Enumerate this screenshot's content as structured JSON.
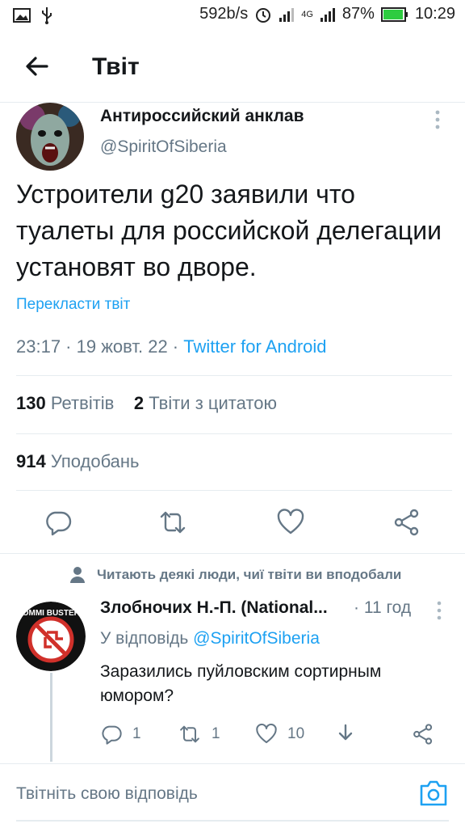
{
  "status_bar": {
    "speed": "592b/s",
    "net": "4G",
    "battery": "87%",
    "time": "10:29"
  },
  "header": {
    "title": "Твіт"
  },
  "tweet": {
    "author_name": "Антироссийский анклав",
    "author_handle": "@SpiritOfSiberia",
    "text": "Устроители g20 заявили что туалеты для российской делегации установят во дворе.",
    "translate_label": "Перекласти твіт",
    "time": "23:17 · 19 жовт. 22 · ",
    "source": "Twitter for Android",
    "retweets_count": "130",
    "retweets_label": "Ретвітів",
    "quotes_count": "2",
    "quotes_label": "Твіти з цитатою",
    "likes_count": "914",
    "likes_label": "Уподобань"
  },
  "reply": {
    "social_context": "Читають деякі люди, чиї твіти ви вподобали",
    "avatar_text": "COMMI BUSTERS",
    "author_name": "Злобночих Н.-П. (National...",
    "time": "· 11 год",
    "reply_prefix": "У відповідь",
    "reply_to": "@SpiritOfSiberia",
    "text": "Заразились пуйловским сортирным юмором?",
    "reply_count": "1",
    "retweet_count": "1",
    "like_count": "10"
  },
  "compose": {
    "placeholder": "Твітніть свою відповідь"
  },
  "colors": {
    "accent": "#1da1f2",
    "secondary_text": "#657786",
    "border": "#e6ecf0"
  }
}
